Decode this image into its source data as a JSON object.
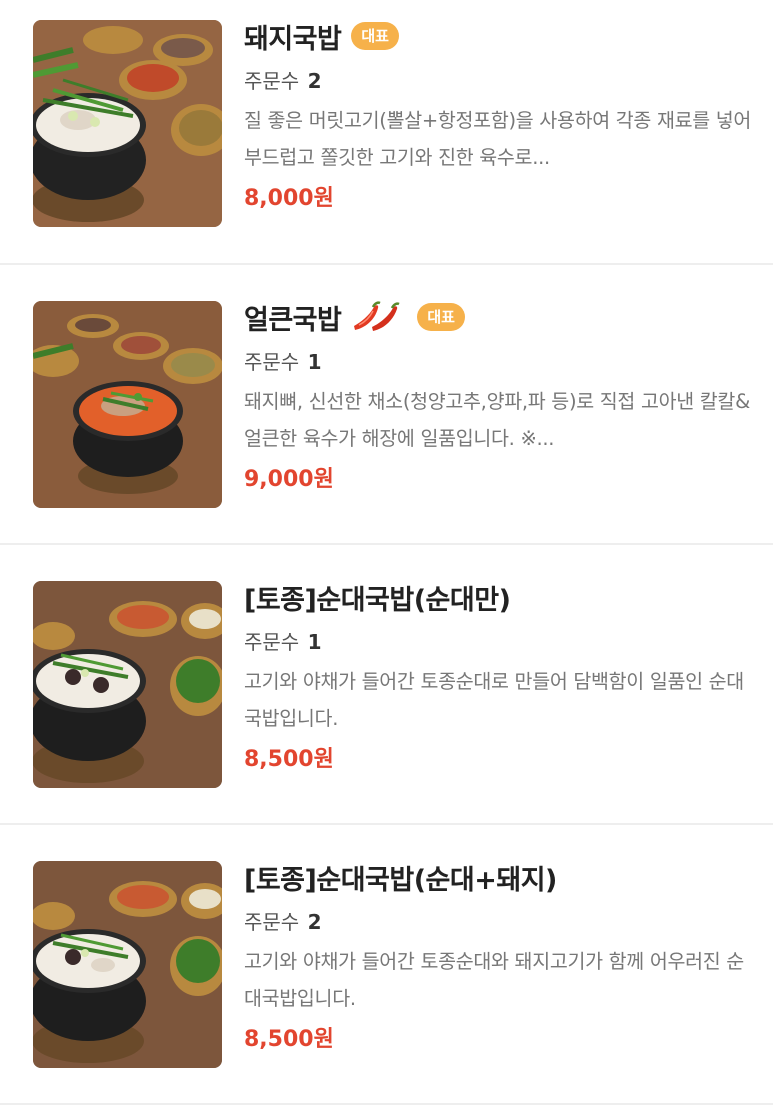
{
  "colors": {
    "price": "#e2452f",
    "badge_bg": "#f6b14a",
    "divider": "#eeeeee"
  },
  "menu": [
    {
      "name": "돼지국밥",
      "badge": "대표",
      "spicy_icon": null,
      "orders_label": "주문수",
      "orders_count": "2",
      "description": "질 좋은 머릿고기(뽈살+항정포함)을 사용하여 각종 재료를 넣어 부드럽고 쫄깃한 고기와 진한 육수로...",
      "price": "8,000원",
      "image_icon": "pork-soup-photo"
    },
    {
      "name": "얼큰국밥",
      "badge": "대표",
      "spicy_icon": "chili-pepper-icon",
      "orders_label": "주문수",
      "orders_count": "1",
      "description": "돼지뼈, 신선한 채소(청양고추,양파,파 등)로 직접 고아낸 칼칼&얼큰한 육수가 해장에 일품입니다. ※...",
      "price": "9,000원",
      "image_icon": "spicy-soup-photo"
    },
    {
      "name": "[토종]순대국밥(순대만)",
      "badge": null,
      "spicy_icon": null,
      "orders_label": "주문수",
      "orders_count": "1",
      "description": "고기와 야채가 들어간 토종순대로 만들어 담백함이 일품인 순대국밥입니다.",
      "price": "8,500원",
      "image_icon": "sundae-soup-photo"
    },
    {
      "name": "[토종]순대국밥(순대+돼지)",
      "badge": null,
      "spicy_icon": null,
      "orders_label": "주문수",
      "orders_count": "2",
      "description": "고기와 야채가 들어간 토종순대와 돼지고기가 함께 어우러진 순대국밥입니다.",
      "price": "8,500원",
      "image_icon": "sundae-pork-soup-photo"
    }
  ]
}
